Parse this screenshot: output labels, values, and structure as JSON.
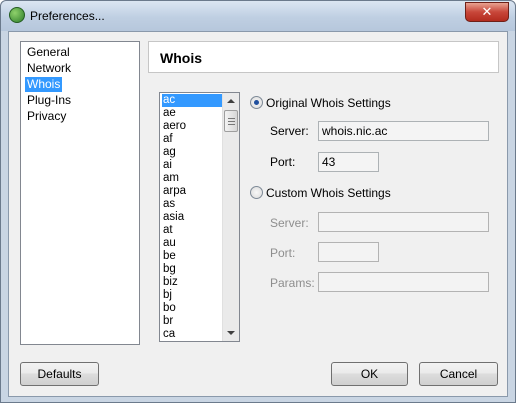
{
  "window": {
    "title": "Preferences..."
  },
  "nav": {
    "items": [
      {
        "label": "General"
      },
      {
        "label": "Network"
      },
      {
        "label": "Whois"
      },
      {
        "label": "Plug-Ins"
      },
      {
        "label": "Privacy"
      }
    ],
    "selected": "Whois"
  },
  "panel": {
    "title": "Whois"
  },
  "tld_list": {
    "items": [
      "ac",
      "ae",
      "aero",
      "af",
      "ag",
      "ai",
      "am",
      "arpa",
      "as",
      "asia",
      "at",
      "au",
      "be",
      "bg",
      "biz",
      "bj",
      "bo",
      "br",
      "ca"
    ],
    "selected": "ac"
  },
  "original": {
    "label": "Original Whois Settings",
    "checked": true,
    "server_label": "Server:",
    "server_value": "whois.nic.ac",
    "port_label": "Port:",
    "port_value": "43"
  },
  "custom": {
    "label": "Custom Whois Settings",
    "checked": false,
    "server_label": "Server:",
    "server_value": "",
    "port_label": "Port:",
    "port_value": "",
    "params_label": "Params:",
    "params_value": ""
  },
  "buttons": {
    "defaults": "Defaults",
    "ok": "OK",
    "cancel": "Cancel"
  },
  "colors": {
    "selection": "#3399ff",
    "close": "#c8473a"
  }
}
